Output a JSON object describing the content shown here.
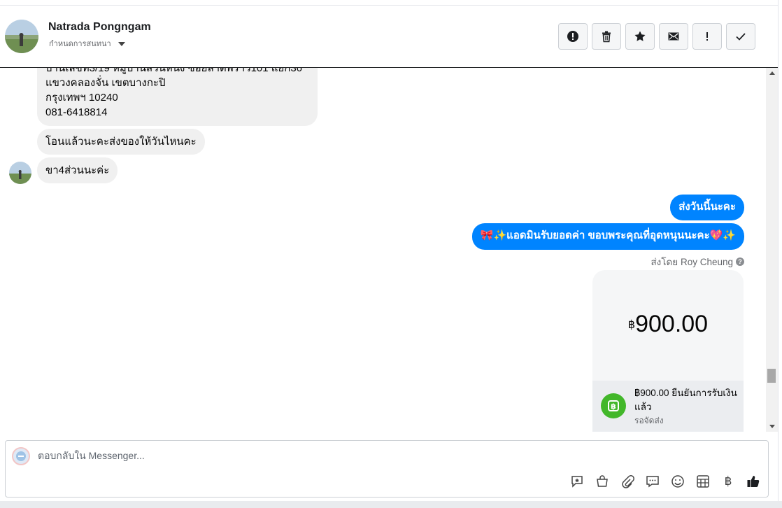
{
  "header": {
    "contact_name": "Natrada Pongngam",
    "subtitle": "กำหนดการสนทนา",
    "toolbar": [
      {
        "name": "report-spam-button",
        "icon": "alert-circle-icon"
      },
      {
        "name": "delete-button",
        "icon": "trash-icon"
      },
      {
        "name": "star-button",
        "icon": "star-icon"
      },
      {
        "name": "mark-unread-button",
        "icon": "envelope-icon"
      },
      {
        "name": "follow-up-button",
        "icon": "exclamation-icon"
      },
      {
        "name": "mark-done-button",
        "icon": "check-icon"
      }
    ]
  },
  "messages": {
    "incoming": [
      {
        "lines": [
          "บ้านเลขที่3/19 หมู่บ้านสวนหนึ่ง ซอยลาดพร้าว101 แยก36",
          "แขวงคลองจั่น เขตบางกะปิ",
          "กรุงเทพฯ 10240",
          "081-6418814"
        ]
      },
      {
        "text": "โอนแล้วนะคะส่งของให้วันไหนคะ"
      },
      {
        "text": "ขา4ส่วนนะค่ะ"
      }
    ],
    "outgoing": [
      {
        "text": "ส่งวันนี้นะคะ"
      },
      {
        "text": "🎀✨แอดมินรับยอดค่า ขอบพระคุณที่อุดหนุนนะคะ💖✨"
      }
    ],
    "sent_by": "ส่งโดย Roy Cheung"
  },
  "payment": {
    "currency_symbol": "฿",
    "amount": "900.00",
    "status_line": "฿900.00 ยืนยันการรับเงินแล้ว",
    "substatus": "รอจัดส่ง",
    "accent_color": "#42b72a"
  },
  "composer": {
    "placeholder": "ตอบกลับใน Messenger...",
    "tools": [
      "saved-reply-icon",
      "shopping-bag-icon",
      "paperclip-icon",
      "chat-bubbles-icon",
      "smiley-icon",
      "table-icon",
      "baht-icon",
      "thumbs-up-icon"
    ],
    "baht_glyph": "฿"
  },
  "colors": {
    "outgoing_bubble": "#0084ff",
    "incoming_bubble": "#f0f0f0"
  }
}
